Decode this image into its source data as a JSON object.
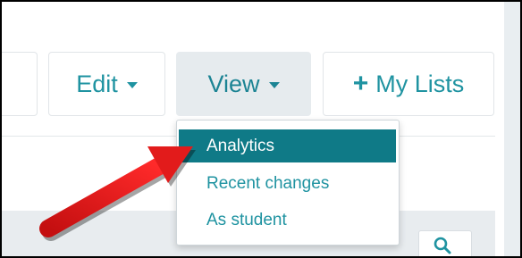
{
  "toolbar": {
    "edit_label": "Edit",
    "view_label": "View",
    "mylists_label": "My Lists"
  },
  "view_menu": {
    "items": [
      {
        "label": "Analytics",
        "highlighted": true
      },
      {
        "label": "Recent changes"
      },
      {
        "label": "As student"
      }
    ]
  },
  "colors": {
    "accent": "#1f93a1",
    "highlight": "#0f7a87",
    "annotation_arrow": "#e21b1b"
  },
  "icons": {
    "search": "search-icon",
    "plus": "plus-icon",
    "caret": "caret-down-icon"
  }
}
